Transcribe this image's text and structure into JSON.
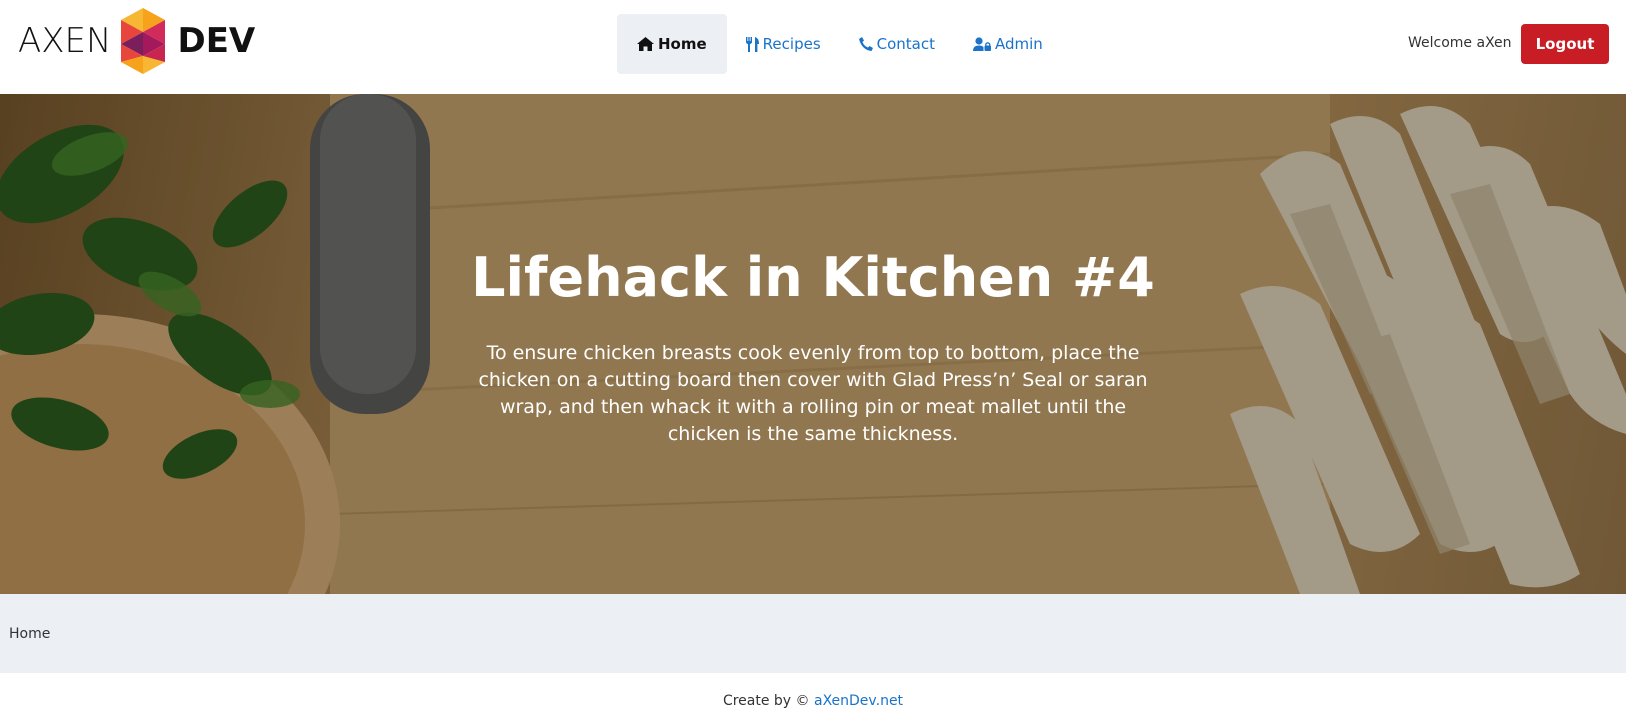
{
  "brand": {
    "left": "AXEN",
    "right": "DEV"
  },
  "nav": {
    "items": [
      {
        "label": "Home",
        "icon": "home-icon",
        "active": true
      },
      {
        "label": "Recipes",
        "icon": "utensils-icon",
        "active": false
      },
      {
        "label": "Contact",
        "icon": "phone-icon",
        "active": false
      },
      {
        "label": "Admin",
        "icon": "user-lock-icon",
        "active": false
      }
    ]
  },
  "user": {
    "welcome": "Welcome aXen",
    "logout_label": "Logout"
  },
  "hero": {
    "title": "Lifehack in Kitchen #4",
    "text": "To ensure chicken breasts cook evenly from top to bottom, place the chicken on a cutting board then cover with Glad Press’n’ Seal or saran wrap, and then whack it with a rolling pin or meat mallet until the chicken is the same thickness."
  },
  "breadcrumb": {
    "current": "Home"
  },
  "footer": {
    "prefix": "Create by ©",
    "link": "aXenDev.net"
  },
  "colors": {
    "accent": "#1a73c9",
    "logout": "#c81d25",
    "breadcrumb_bg": "#eceff4",
    "nav_active_bg": "#eceff3"
  }
}
